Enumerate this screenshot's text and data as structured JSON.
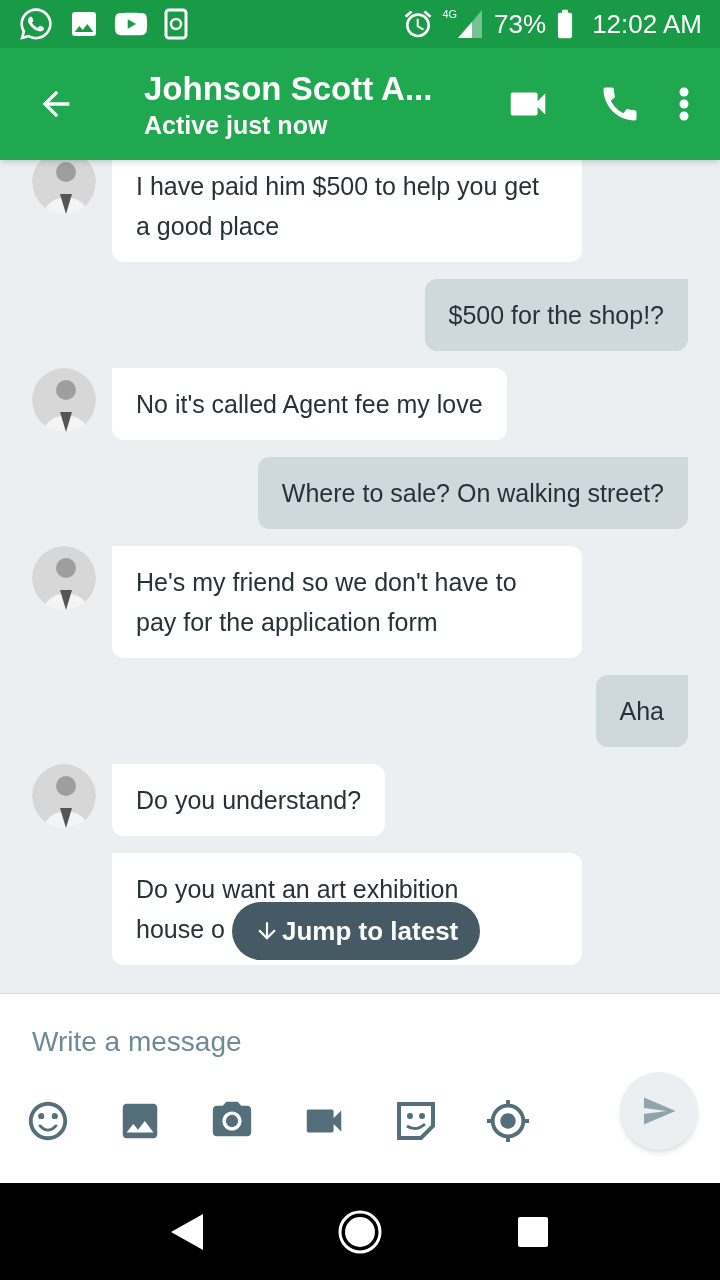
{
  "status_bar": {
    "network": "4G",
    "battery": "73%",
    "time": "12:02 AM"
  },
  "header": {
    "title": "Johnson Scott A...",
    "subtitle": "Active just now"
  },
  "messages": [
    {
      "text": "I have paid him $500 to help you get a good place",
      "outgoing": false,
      "avatar": true
    },
    {
      "text": "$500 for the shop!?",
      "outgoing": true
    },
    {
      "text": "No it's called Agent fee my love",
      "outgoing": false,
      "avatar": true
    },
    {
      "text": "Where to sale? On walking street?",
      "outgoing": true
    },
    {
      "text": "He's my friend so we don't have to pay for the application form",
      "outgoing": false,
      "avatar": true
    },
    {
      "text": "Aha",
      "outgoing": true
    },
    {
      "text": "Do you understand?",
      "outgoing": false,
      "avatar": true
    },
    {
      "text": "Do you want an art exhibition house o",
      "outgoing": false,
      "avatar": false
    }
  ],
  "jump_button": {
    "label": "Jump to latest"
  },
  "composer": {
    "placeholder": "Write a message"
  }
}
